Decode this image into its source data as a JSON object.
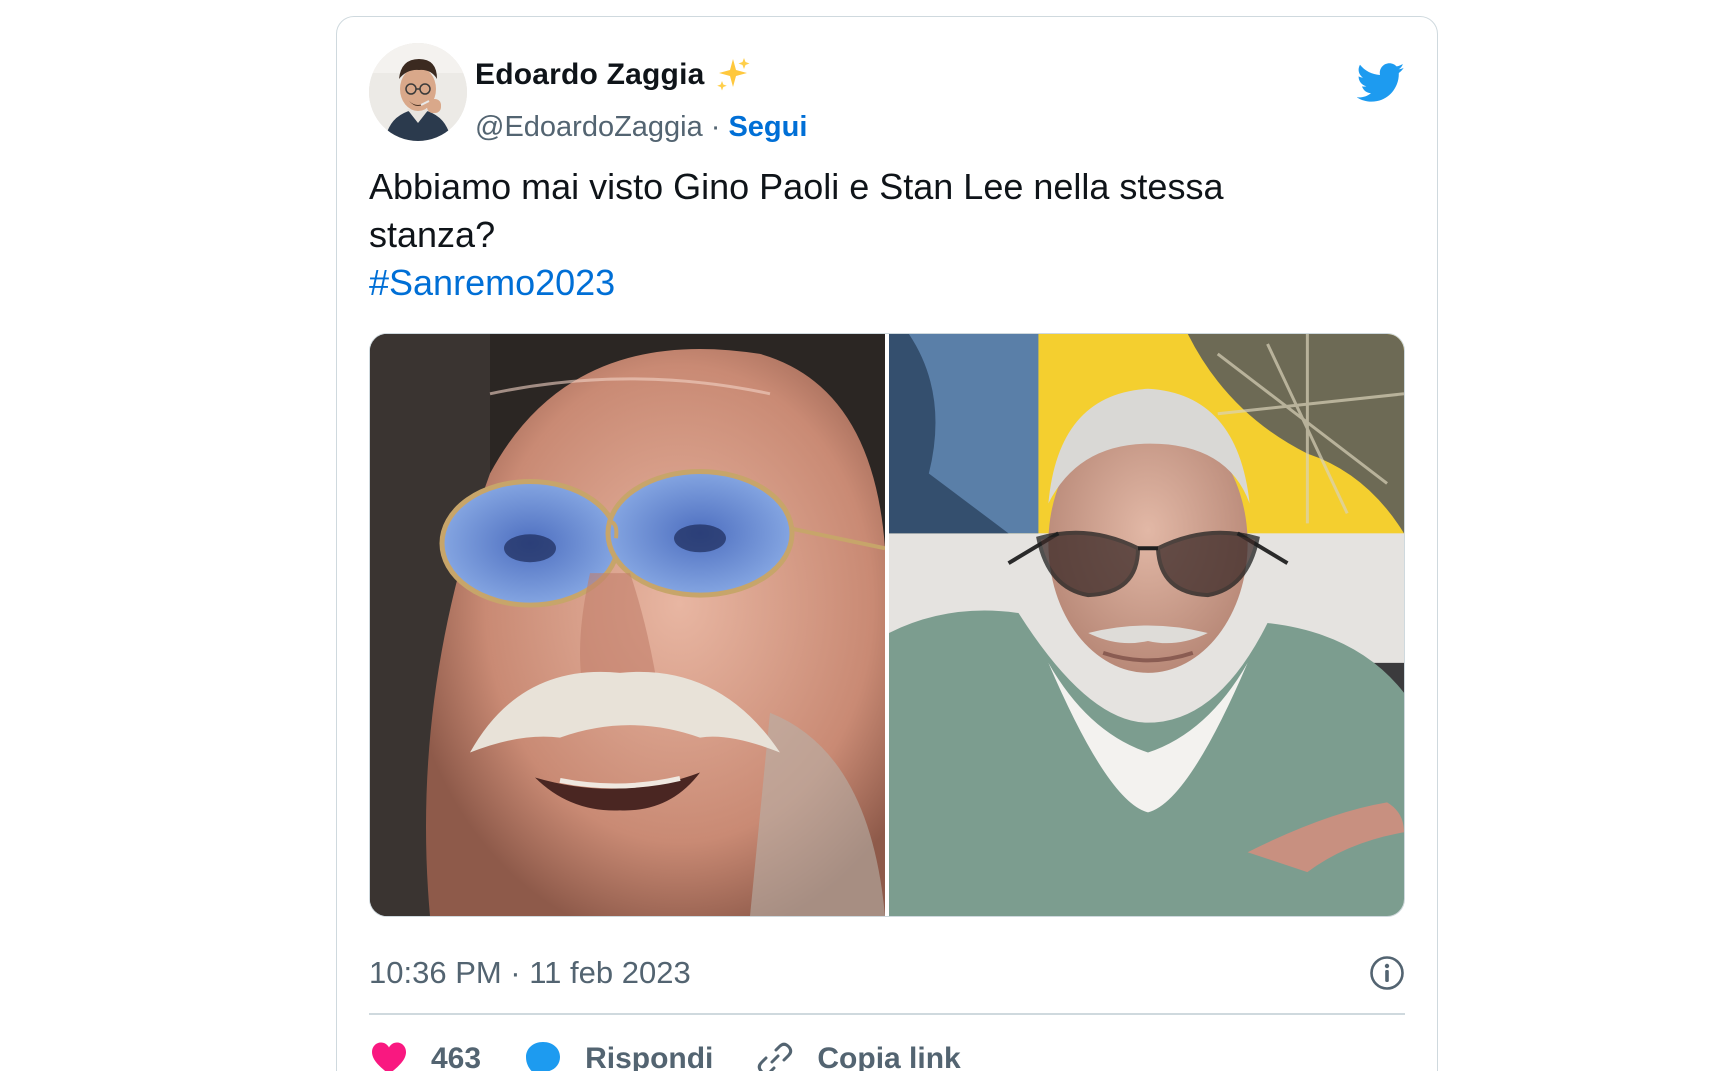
{
  "tweet": {
    "author": {
      "name": "Edoardo Zaggia",
      "handle": "@EdoardoZaggia",
      "separator": "·",
      "follow_label": "Segui",
      "badge_icon": "sparkles-icon"
    },
    "text_lines": [
      "Abbiamo mai visto Gino Paoli e Stan Lee nella stessa",
      "stanza?"
    ],
    "hashtag": "#Sanremo2023",
    "timestamp": "10:36 PM · 11 feb 2023",
    "actions": {
      "likes_count": "463",
      "reply_label": "Rispondi",
      "copy_link_label": "Copia link"
    },
    "colors": {
      "link_blue": "#006fd6",
      "twitter_blue": "#1d9bf0",
      "heart_pink": "#f91880",
      "muted_text": "#536471",
      "main_text": "#0f1419",
      "border": "#cfd9de"
    },
    "icons": [
      "twitter-bird-icon",
      "info-icon",
      "heart-icon",
      "reply-bubble-icon",
      "link-icon"
    ]
  }
}
